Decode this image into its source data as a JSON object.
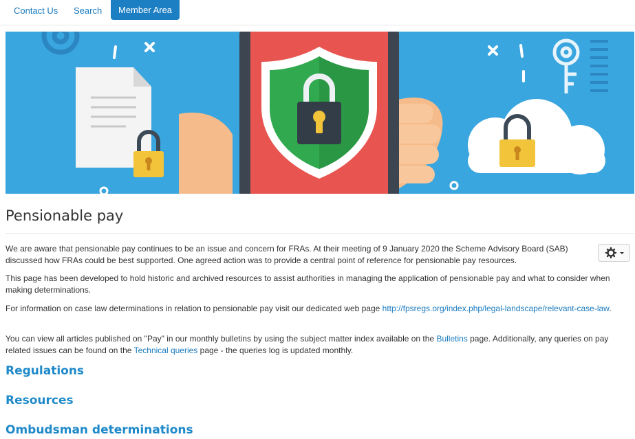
{
  "nav": {
    "contact_label": "Contact Us",
    "search_label": "Search",
    "member_area_label": "Member Area"
  },
  "banner": {
    "icons": [
      "gear-icon",
      "document-icon",
      "padlock-icon",
      "smartphone-icon",
      "shield-icon",
      "hand-icon",
      "cloud-icon",
      "key-icon"
    ],
    "colors": {
      "background": "#3aa6df",
      "phone": "#e85450",
      "shield": "#31a94e",
      "padlock": "#f2c43a"
    }
  },
  "page": {
    "title": "Pensionable pay",
    "para1": "We are aware that pensionable pay continues to be an issue and concern for FRAs. At their meeting of 9 January 2020 the Scheme Advisory Board (SAB) discussed how FRAs could be best supported. One agreed action was to provide a central point of reference for pensionable pay resources.",
    "para2": "This page has been developed to hold historic and archived resources to assist authorities in managing the application of pensionable pay and what to consider when making determinations.",
    "para3_text": "For information on case law determinations in relation to pensionable pay visit our dedicated web page ",
    "para3_link": "http://fpsregs.org/index.php/legal-landscape/relevant-case-law",
    "para3_end": ".",
    "para4_a": "You can view all articles published on \"Pay\" in our monthly bulletins by using the subject matter index available on the ",
    "para4_link1": "Bulletins",
    "para4_b": " page. Additionally, any queries on pay related issues can be found on the ",
    "para4_link2": "Technical queries",
    "para4_c": " page - the queries log is updated monthly."
  },
  "sections": {
    "regulations": "Regulations",
    "resources": "Resources",
    "ombudsman": "Ombudsman determinations"
  },
  "colors": {
    "link": "#1a7bbf",
    "heading": "#1f8ac9",
    "button": "#1d7fc3"
  }
}
